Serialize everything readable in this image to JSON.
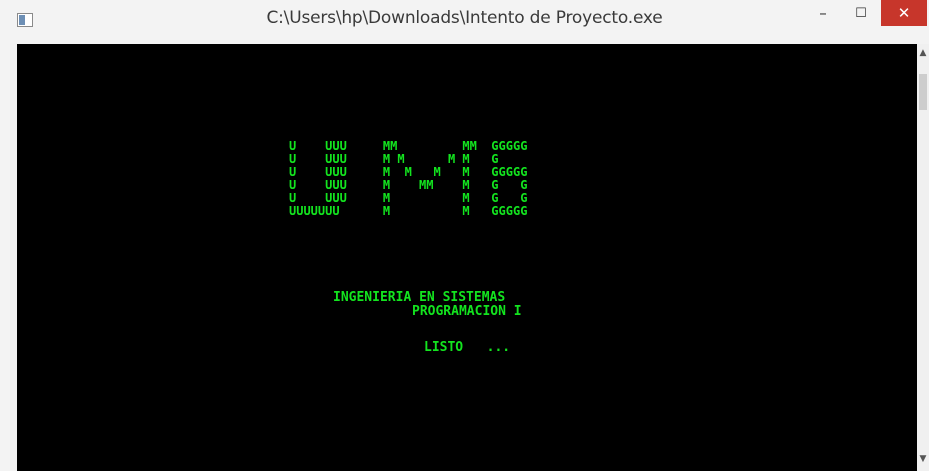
{
  "window": {
    "title": "C:\\Users\\hp\\Downloads\\Intento de Proyecto.exe",
    "minimize_glyph": "–",
    "maximize_glyph": "☐",
    "close_glyph": "✕"
  },
  "console": {
    "logo_lines": [
      "U    UUU     MM         MM  GGGGG",
      "U    UUU     M M      M M   G",
      "U    UUU     M  M   M   M   GGGGG",
      "U    UUU     M    MM    M   G   G",
      "U    UUU     M          M   G   G",
      "UUUUUUU      M          M   GGGGG"
    ],
    "line_1": "INGENIERIA EN SISTEMAS",
    "line_2": "PROGRAMACION I",
    "line_3": "LISTO   ..."
  },
  "colors": {
    "console_bg": "#000000",
    "console_text": "#13e41f",
    "close_button": "#c7362b"
  },
  "icons": [
    "console-app-icon",
    "scroll-up-arrow-icon",
    "scroll-down-arrow-icon"
  ]
}
